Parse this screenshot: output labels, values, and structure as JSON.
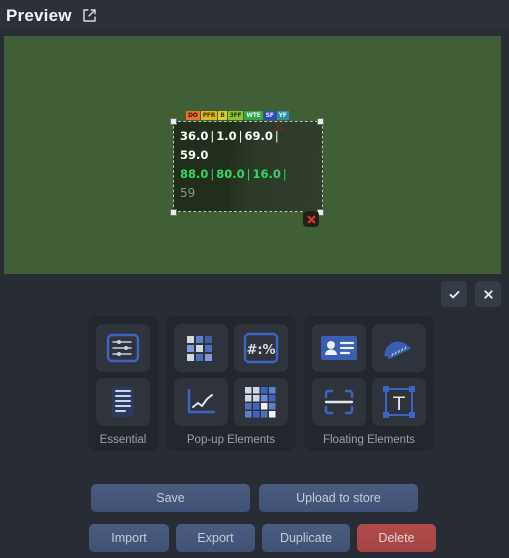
{
  "header": {
    "title": "Preview",
    "external_link_icon": "external-link-icon"
  },
  "canvas": {
    "background_color": "#415F37",
    "widget": {
      "badges": [
        {
          "text": "DO",
          "bg": "#e8742c",
          "fg": "#3a1b05"
        },
        {
          "text": "PFR",
          "bg": "#e0b824",
          "fg": "#4a3a03"
        },
        {
          "text": "B",
          "bg": "#d9d12a",
          "fg": "#3f3c04"
        },
        {
          "text": "3FF",
          "bg": "#8fc52c",
          "fg": "#273a05"
        },
        {
          "text": "WTE",
          "bg": "#2fa84a",
          "fg": "#e9f7ea"
        },
        {
          "text": "SF",
          "bg": "#2f49c9",
          "fg": "#e6e9fb"
        },
        {
          "text": "YF",
          "bg": "#2f8fa8",
          "fg": "#e6f4f8"
        }
      ],
      "line_white": [
        "36.0",
        "1.0",
        "69.0",
        "59.0"
      ],
      "line_green": [
        "88.0",
        "80.0",
        "16.0"
      ],
      "line_gray": "59",
      "separator": "|",
      "white_color": "#FFFFFF",
      "green_color": "#2FD968",
      "gray_color": "#8E958A",
      "delete_chip_icon": "red-x-delete-icon",
      "handles": [
        "resize-handle-top-left",
        "resize-handle-top-right",
        "resize-handle-bottom-left",
        "resize-handle-bottom-right"
      ]
    }
  },
  "confirm_bar": {
    "accept_icon": "checkmark-icon",
    "cancel_icon": "close-x-icon"
  },
  "palette": {
    "groups": [
      {
        "label": "Essential",
        "tiles": [
          {
            "icon": "settings-sliders-icon",
            "selected": true
          },
          {
            "icon": "list-lines-icon",
            "selected": false
          }
        ]
      },
      {
        "label": "Pop-up Elements",
        "tiles": [
          {
            "icon": "grid-blocks-icon",
            "selected": false
          },
          {
            "icon": "number-percent-icon",
            "selected": true
          },
          {
            "icon": "line-chart-icon",
            "selected": false
          },
          {
            "icon": "pixel-grid-icon",
            "selected": false
          }
        ]
      },
      {
        "label": "Floating Elements",
        "tiles": [
          {
            "icon": "id-card-icon",
            "selected": false
          },
          {
            "icon": "protractor-gauge-icon",
            "selected": false
          },
          {
            "icon": "scan-line-icon",
            "selected": false
          },
          {
            "icon": "text-box-icon",
            "selected": true
          }
        ]
      }
    ]
  },
  "actions": {
    "save": "Save",
    "upload": "Upload to store",
    "import": "Import",
    "export": "Export",
    "duplicate": "Duplicate",
    "delete": "Delete",
    "accent_blue": "#4A5C80",
    "danger_red": "#B14B4B"
  }
}
